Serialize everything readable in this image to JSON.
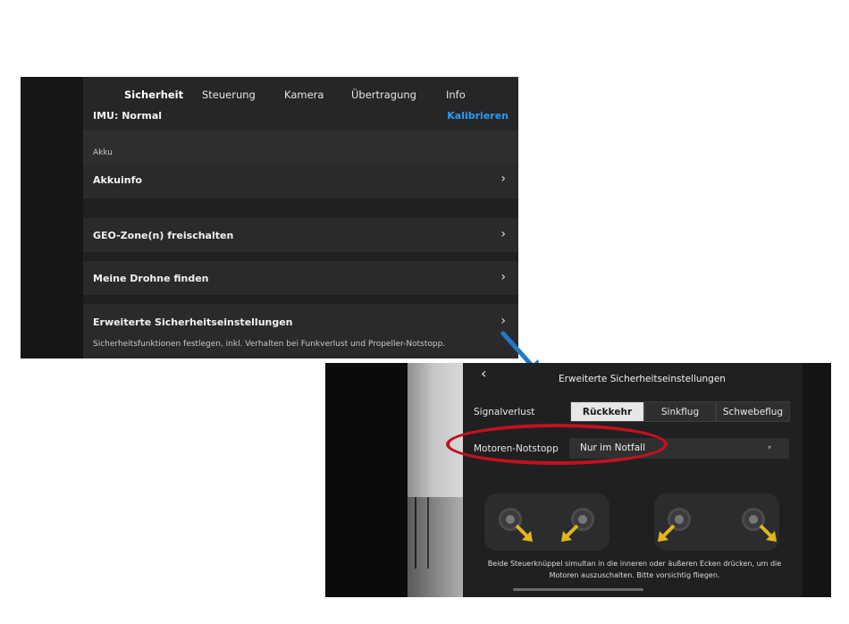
{
  "settings": {
    "tabs": [
      {
        "label": "Sicherheit"
      },
      {
        "label": "Steuerung"
      },
      {
        "label": "Kamera"
      },
      {
        "label": "Übertragung"
      },
      {
        "label": "Info"
      }
    ],
    "imu": {
      "label": "IMU: Normal",
      "action": "Kalibrieren"
    },
    "section_akku": "Akku",
    "akkuinfo": "Akkuinfo",
    "geo": "GEO-Zone(n) freischalten",
    "finden": "Meine Drohne finden",
    "erweitert": {
      "label": "Erweiterte Sicherheitseinstellungen",
      "subtitle": "Sicherheitsfunktionen festlegen, inkl. Verhalten bei Funkverlust und Propeller-Notstopp."
    },
    "chevron": "›"
  },
  "advanced": {
    "back": "‹",
    "title": "Erweiterte Sicherheitseinstellungen",
    "signal_label": "Signalverlust",
    "signal_options": [
      "Rückkehr",
      "Sinkflug",
      "Schwebeflug"
    ],
    "signal_selected": "Rückkehr",
    "motor_label": "Motoren-Notstopp",
    "motor_value": "Nur im Notfall",
    "caret": "▾",
    "instruction_line1": "Beide Steuerknüppel simultan in die inneren oder äußeren Ecken drücken, um die",
    "instruction_line2": "Motoren auszuschalten. Bitte vorsichtig fliegen."
  },
  "colors": {
    "accent": "#2a9cf3",
    "annotation_red": "#c1121f",
    "arrow_blue": "#1f78c8",
    "stick_arrow_yellow": "#e2b51c"
  },
  "icons": [
    "chevron-right-icon",
    "back-chevron-icon",
    "dropdown-caret-icon",
    "annotation-arrow-icon",
    "stick-direction-arrow-icon"
  ]
}
